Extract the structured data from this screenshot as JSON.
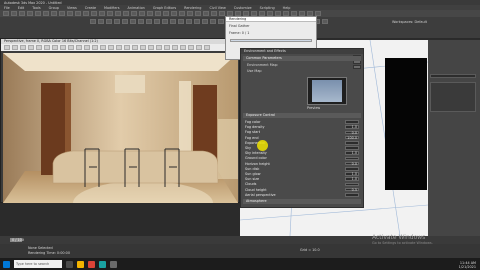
{
  "app": {
    "title": "Autodesk 3ds Max 2020 - Untitled",
    "menus": [
      "File",
      "Edit",
      "Tools",
      "Group",
      "Views",
      "Create",
      "Modifiers",
      "Animation",
      "Graph Editors",
      "Rendering",
      "Civil View",
      "Customize",
      "Scripting",
      "Help"
    ],
    "workspace_label": "Workspaces: Default"
  },
  "vfb": {
    "title": "Perspective, frame 0, RGBA Color 16 Bits/Channel (1:2)",
    "area_label": "Area to Render: View",
    "channel_label": "RGB Alpha"
  },
  "render_setup": {
    "title": "Rendering",
    "subtitle": "Final Gather",
    "status": "Frame: 0 / 1"
  },
  "environment": {
    "title": "Environment and Effects",
    "rollout_common": "Common Parameters",
    "rollout_exposure": "Exposure Control",
    "rollout_atmosphere": "Atmosphere",
    "map_label": "Environment Map:",
    "use_map_label": "Use Map",
    "preview_label": "Preview",
    "fields": [
      {
        "label": "Fog color",
        "value": ""
      },
      {
        "label": "Fog density",
        "value": "1.0"
      },
      {
        "label": "Fog start",
        "value": "0.0"
      },
      {
        "label": "Fog end",
        "value": "100.0"
      },
      {
        "label": "Exponential",
        "value": ""
      },
      {
        "label": "Sky",
        "value": ""
      },
      {
        "label": "Sky intensity",
        "value": "1.0"
      },
      {
        "label": "Ground color",
        "value": ""
      },
      {
        "label": "Horizon height",
        "value": "0.0"
      },
      {
        "label": "Sun disk",
        "value": ""
      },
      {
        "label": "Sun glow",
        "value": "1.0"
      },
      {
        "label": "Sun size",
        "value": "1.0"
      },
      {
        "label": "Clouds",
        "value": ""
      },
      {
        "label": "Cloud height",
        "value": "0.5"
      },
      {
        "label": "Aerial perspective",
        "value": ""
      }
    ]
  },
  "viewport": {
    "label": "[+] [Top] [Standard] [Wireframe]"
  },
  "status": {
    "selected": "None Selected",
    "hint": "Rendering Time: 0:00:00",
    "frame_counter": "0 / 100",
    "grid": "Grid = 10.0"
  },
  "watermark": {
    "line1": "Activate Windows",
    "line2": "Go to Settings to activate Windows."
  },
  "taskbar": {
    "search_placeholder": "Type here to search",
    "time": "11:44 AM",
    "date": "1/21/2021"
  },
  "colors": {
    "accent": "#f0e300",
    "render_wood": "#6b3a1e",
    "render_plaster": "#d9c3a0"
  }
}
